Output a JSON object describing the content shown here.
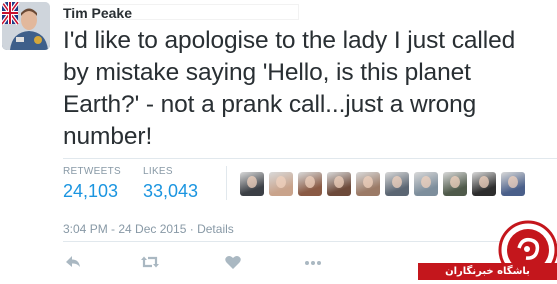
{
  "tweet": {
    "author_name": "Tim Peake",
    "text": "I'd like to apologise to the lady I just called\nby mistake saying 'Hello, is this planet\nEarth?' - not a prank call...just a wrong\nnumber!",
    "timestamp": "3:04 PM - 24 Dec 2015",
    "separator": "·",
    "details_label": "Details"
  },
  "stats": {
    "retweets": {
      "label": "RETWEETS",
      "value": "24,103"
    },
    "likes": {
      "label": "LIKES",
      "value": "33,043"
    }
  },
  "likers": [
    {
      "name": "liker-avatar-1",
      "color": "#3b3f45"
    },
    {
      "name": "liker-avatar-2",
      "color": "#c9a38b"
    },
    {
      "name": "liker-avatar-3",
      "color": "#8a5a44"
    },
    {
      "name": "liker-avatar-4",
      "color": "#6d4a3a"
    },
    {
      "name": "liker-avatar-5",
      "color": "#9b7a66"
    },
    {
      "name": "liker-avatar-6",
      "color": "#5b6673"
    },
    {
      "name": "liker-avatar-7",
      "color": "#7d8e9c"
    },
    {
      "name": "liker-avatar-8",
      "color": "#4f5a4a"
    },
    {
      "name": "liker-avatar-9",
      "color": "#2d2d2d"
    },
    {
      "name": "liker-avatar-10",
      "color": "#4a5f8a"
    }
  ],
  "actions": {
    "reply_icon": "reply-icon",
    "retweet_icon": "retweet-icon",
    "like_icon": "heart-icon",
    "more_icon": "more-icon"
  },
  "watermark": {
    "text": "باشگاه خبرنگاران",
    "color": "#c4161c"
  },
  "colors": {
    "text": "#292f33",
    "muted": "#8899a6",
    "link": "#1b95e0",
    "divider": "#e1e8ed",
    "icon": "#aab8c2"
  }
}
